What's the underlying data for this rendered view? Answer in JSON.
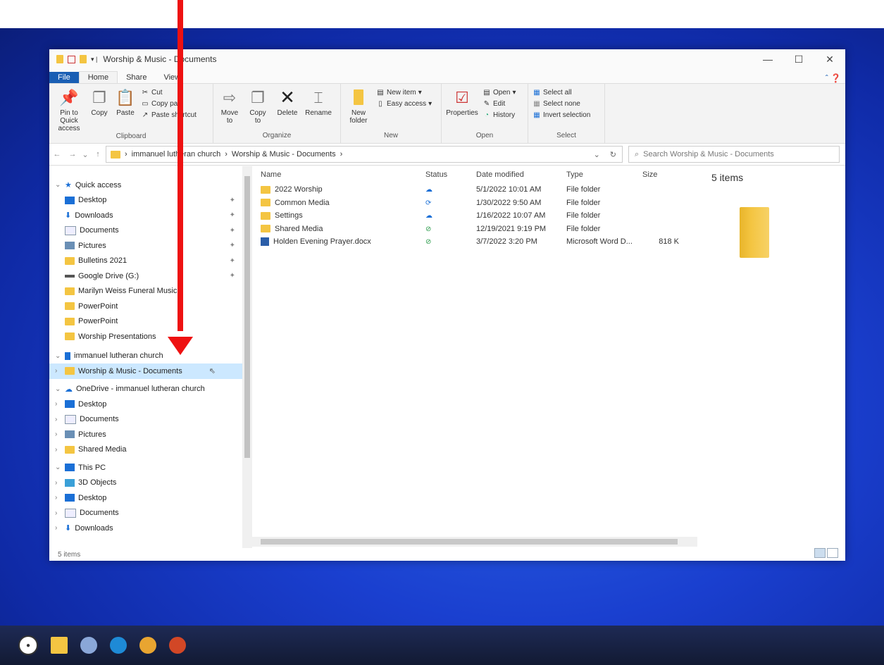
{
  "window": {
    "title": "Worship & Music - Documents",
    "tabs": [
      "File",
      "Home",
      "Share",
      "View"
    ]
  },
  "ribbon": {
    "clipboard": {
      "label": "Clipboard",
      "pin": "Pin to Quick access",
      "copy": "Copy",
      "paste": "Paste",
      "cut": "Cut",
      "copy_path": "Copy path",
      "paste_shortcut": "Paste shortcut"
    },
    "organize": {
      "label": "Organize",
      "move_to": "Move to",
      "copy_to": "Copy to",
      "delete": "Delete",
      "rename": "Rename"
    },
    "new": {
      "label": "New",
      "new_folder": "New folder",
      "new_item": "New item",
      "easy_access": "Easy access"
    },
    "open": {
      "label": "Open",
      "properties": "Properties",
      "open": "Open",
      "edit": "Edit",
      "history": "History"
    },
    "select": {
      "label": "Select",
      "select_all": "Select all",
      "select_none": "Select none",
      "invert": "Invert selection"
    }
  },
  "address": {
    "crumbs": [
      "immanuel lutheran church",
      "Worship & Music - Documents"
    ],
    "search_placeholder": "Search Worship & Music - Documents"
  },
  "nav": {
    "quick_access": "Quick access",
    "quick_items": [
      "Desktop",
      "Downloads",
      "Documents",
      "Pictures",
      "Bulletins 2021",
      "Google Drive (G:)",
      "Marilyn Weiss Funeral Music",
      "PowerPoint",
      "PowerPoint",
      "Worship Presentations"
    ],
    "site": "immanuel lutheran church",
    "site_child": "Worship & Music - Documents",
    "onedrive": "OneDrive - immanuel lutheran church",
    "onedrive_items": [
      "Desktop",
      "Documents",
      "Pictures",
      "Shared Media"
    ],
    "thispc": "This PC",
    "pc_items": [
      "3D Objects",
      "Desktop",
      "Documents",
      "Downloads"
    ]
  },
  "columns": {
    "name": "Name",
    "status": "Status",
    "date": "Date modified",
    "type": "Type",
    "size": "Size"
  },
  "files": [
    {
      "name": "2022 Worship",
      "date": "5/1/2022 10:01 AM",
      "type": "File folder",
      "size": ""
    },
    {
      "name": "Common Media",
      "date": "1/30/2022 9:50 AM",
      "type": "File folder",
      "size": ""
    },
    {
      "name": "Settings",
      "date": "1/16/2022 10:07 AM",
      "type": "File folder",
      "size": ""
    },
    {
      "name": "Shared Media",
      "date": "12/19/2021 9:19 PM",
      "type": "File folder",
      "size": ""
    },
    {
      "name": "Holden Evening Prayer.docx",
      "date": "3/7/2022 3:20 PM",
      "type": "Microsoft Word D...",
      "size": "818 K"
    }
  ],
  "preview": {
    "count": "5 items"
  },
  "status": {
    "items": "5 items"
  },
  "colors": {
    "accent": "#1a5fb4",
    "folder": "#f4c542",
    "selected": "#cce8ff",
    "arrow": "#ee1111"
  }
}
